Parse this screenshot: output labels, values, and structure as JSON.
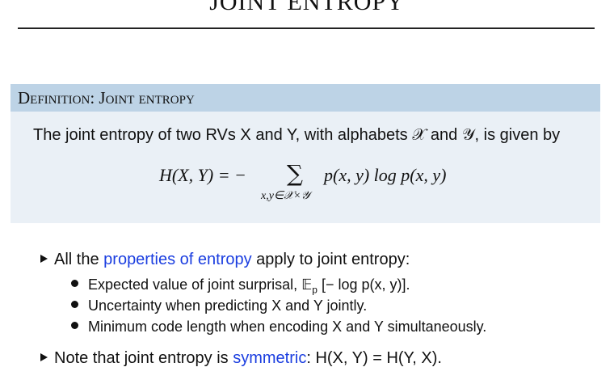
{
  "slide": {
    "title": "JOINT ENTROPY"
  },
  "definition": {
    "header": "Definition: Joint entropy",
    "text": "The joint entropy of two RVs X and Y, with alphabets 𝒳 and 𝒴, is given by",
    "formula_lhs": "H(X, Y) = −",
    "formula_sum": "∑",
    "formula_subscript": "x,y∈𝒳×𝒴",
    "formula_rhs": "p(x, y) log p(x, y)"
  },
  "bullets": [
    {
      "prefix": "All the ",
      "link": "properties of entropy",
      "suffix": " apply to joint entropy:",
      "subitems": [
        {
          "text": "Expected value of joint surprisal, 𝔼",
          "sub": "p",
          "after": " [− log p(x, y)]."
        },
        {
          "text": "Uncertainty when predicting X and Y jointly."
        },
        {
          "text": "Minimum code length when encoding X and Y simultaneously."
        }
      ]
    },
    {
      "prefix": "Note that joint entropy is ",
      "link": "symmetric",
      "suffix": ": H(X, Y) = H(Y, X)."
    }
  ],
  "colors": {
    "header_bg": "#bdd3e6",
    "body_bg": "#eaf0f6",
    "link": "#1b3ee0"
  }
}
